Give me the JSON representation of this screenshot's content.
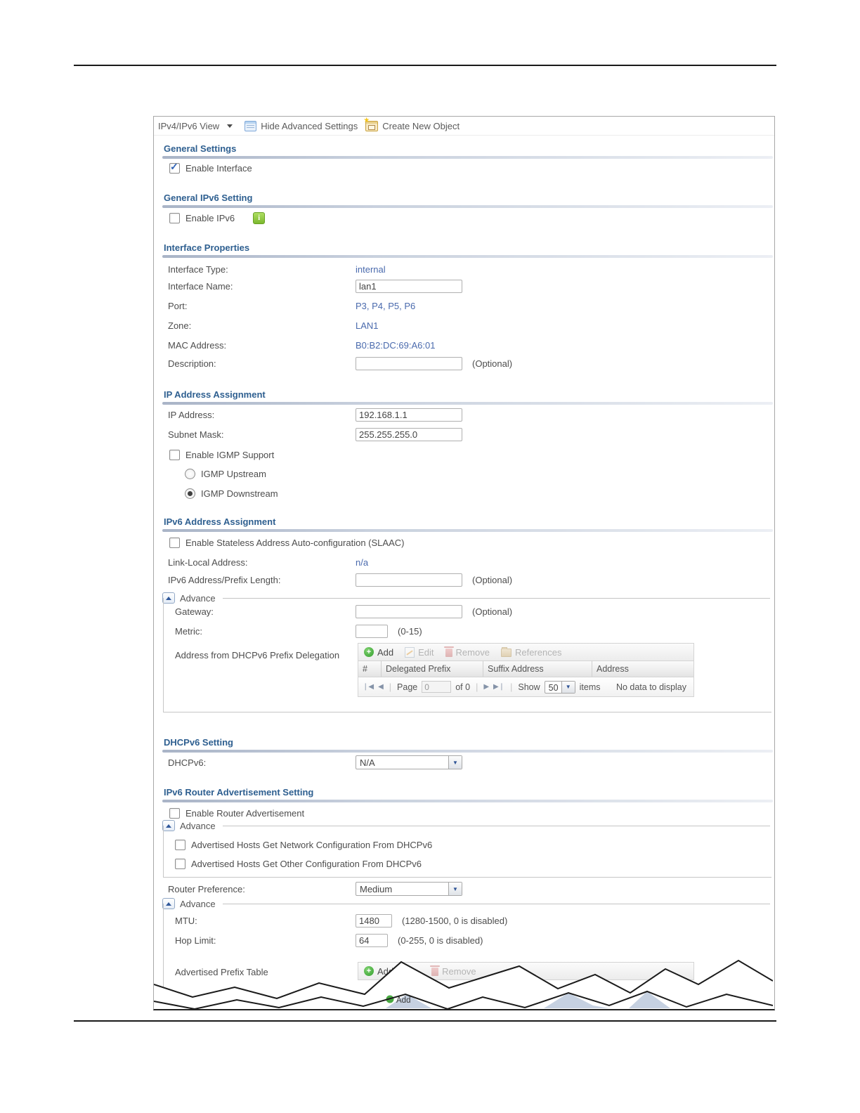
{
  "toolbar": {
    "view_label": "IPv4/IPv6 View",
    "hide_advanced_label": "Hide Advanced Settings",
    "create_object_label": "Create New Object"
  },
  "general_settings": {
    "title": "General Settings",
    "enable_interface_label": "Enable Interface",
    "enable_interface_checked": true
  },
  "general_ipv6_setting": {
    "title": "General IPv6 Setting",
    "enable_ipv6_label": "Enable IPv6",
    "enable_ipv6_checked": false
  },
  "interface_properties": {
    "title": "Interface Properties",
    "interface_type_label": "Interface Type:",
    "interface_type_value": "internal",
    "interface_name_label": "Interface Name:",
    "interface_name_value": "lan1",
    "port_label": "Port:",
    "port_value": "P3, P4, P5, P6",
    "zone_label": "Zone:",
    "zone_value": "LAN1",
    "mac_label": "MAC Address:",
    "mac_value": "B0:B2:DC:69:A6:01",
    "description_label": "Description:",
    "description_value": "",
    "description_hint": "(Optional)"
  },
  "ip_address_assignment": {
    "title": "IP Address Assignment",
    "ip_label": "IP Address:",
    "ip_value": "192.168.1.1",
    "subnet_label": "Subnet Mask:",
    "subnet_value": "255.255.255.0",
    "igmp_label": "Enable IGMP Support",
    "igmp_checked": false,
    "igmp_upstream_label": "IGMP Upstream",
    "igmp_upstream_selected": false,
    "igmp_downstream_label": "IGMP Downstream",
    "igmp_downstream_selected": true
  },
  "ipv6_address_assignment": {
    "title": "IPv6 Address Assignment",
    "slaac_label": "Enable Stateless Address Auto-configuration (SLAAC)",
    "slaac_checked": false,
    "link_local_label": "Link-Local Address:",
    "link_local_value": "n/a",
    "prefix_label": "IPv6 Address/Prefix Length:",
    "prefix_value": "",
    "prefix_hint": "(Optional)",
    "advance": {
      "label": "Advance",
      "gateway_label": "Gateway:",
      "gateway_value": "",
      "gateway_hint": "(Optional)",
      "metric_label": "Metric:",
      "metric_value": "",
      "metric_hint": "(0-15)",
      "pd_label": "Address from DHCPv6 Prefix Delegation",
      "pd_table": {
        "add_label": "Add",
        "edit_label": "Edit",
        "remove_label": "Remove",
        "references_label": "References",
        "columns": [
          "#",
          "Delegated Prefix",
          "Suffix Address",
          "Address"
        ],
        "page_label": "Page",
        "page_value": "0",
        "of_label": "of 0",
        "show_label": "Show",
        "show_value": "50",
        "items_label": "items",
        "empty_text": "No data to display"
      }
    }
  },
  "dhcpv6_setting": {
    "title": "DHCPv6 Setting",
    "dhcpv6_label": "DHCPv6:",
    "dhcpv6_value": "N/A"
  },
  "router_advertisement": {
    "title": "IPv6 Router Advertisement Setting",
    "enable_ra_label": "Enable Router Advertisement",
    "enable_ra_checked": false,
    "advance_hosts": {
      "label": "Advance",
      "network_conf_label": "Advertised Hosts Get Network Configuration From DHCPv6",
      "network_conf_checked": false,
      "other_conf_label": "Advertised Hosts Get Other Configuration From DHCPv6",
      "other_conf_checked": false
    },
    "router_preference_label": "Router Preference:",
    "router_preference_value": "Medium",
    "advance_mtu": {
      "label": "Advance",
      "mtu_label": "MTU:",
      "mtu_value": "1480",
      "mtu_hint": "(1280-1500, 0 is disabled)",
      "hop_label": "Hop Limit:",
      "hop_value": "64",
      "hop_hint": "(0-255, 0 is disabled)",
      "prefix_table_label": "Advertised Prefix Table",
      "prefix_add_label": "Add",
      "prefix_remove_label": "Remove"
    }
  },
  "tear_fragment": {
    "add_label": "Add"
  }
}
